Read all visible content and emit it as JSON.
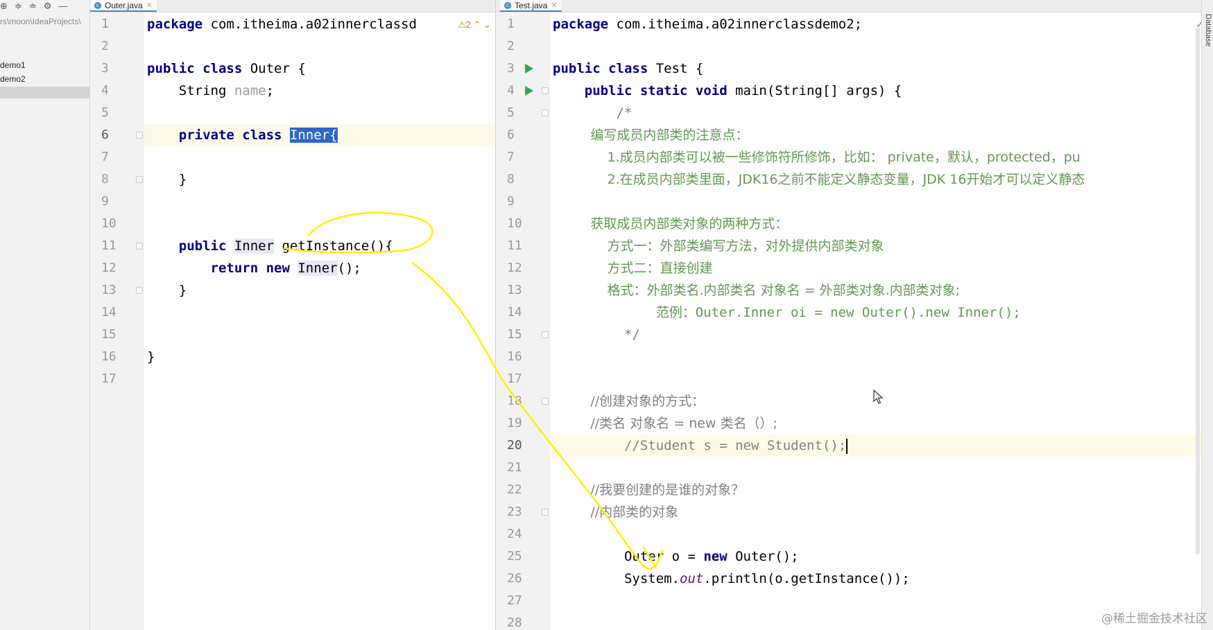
{
  "sidebar": {
    "toolbar_icons": [
      "target-icon",
      "expand-all-icon",
      "collapse-all-icon",
      "gear-icon",
      "minimize-icon"
    ],
    "path": "rs\\moon\\IdeaProjects\\",
    "items": [
      {
        "label": "demo1"
      },
      {
        "label": "demo2"
      }
    ]
  },
  "left_editor": {
    "tab": {
      "label": "Outer.java"
    },
    "warning": {
      "count": "2"
    },
    "lines": [
      "1",
      "2",
      "3",
      "4",
      "5",
      "6",
      "7",
      "8",
      "9",
      "10",
      "11",
      "12",
      "13",
      "14",
      "15",
      "16",
      "17"
    ],
    "code": {
      "l1": {
        "kw": "package",
        "rest": " com.itheima.a02innerclassd"
      },
      "l3": {
        "kw": "public class",
        "rest": " Outer {"
      },
      "l4": {
        "type": "    String ",
        "field": "name",
        ";": ";"
      },
      "l6": {
        "kw": "    private class ",
        "sel": "Inner{"
      },
      "l8": {
        "text": "    }"
      },
      "l11": {
        "kw": "    public ",
        "usage": "Inner",
        "rest": " getInstance(){"
      },
      "l12": {
        "kw": "        return new ",
        "usage": "Inner",
        "rest": "();"
      },
      "l13": {
        "text": "    }"
      },
      "l16": {
        "text": "}"
      }
    }
  },
  "right_editor": {
    "tab": {
      "label": "Test.java"
    },
    "db_label": "Database",
    "lines": [
      "1",
      "2",
      "3",
      "4",
      "5",
      "6",
      "7",
      "8",
      "9",
      "10",
      "11",
      "12",
      "13",
      "14",
      "15",
      "16",
      "17",
      "18",
      "19",
      "20",
      "21",
      "22",
      "23",
      "24",
      "25",
      "26",
      "27",
      "28"
    ],
    "code": {
      "l1": {
        "kw": "package",
        "rest": " com.itheima.a02innerclassdemo2;"
      },
      "l3": {
        "kw": "public class",
        "rest": " Test {"
      },
      "l4": {
        "kw": "    public static void",
        "rest": " main(String[] args) {"
      },
      "l5": "        /*",
      "l6": "         编写成员内部类的注意点：",
      "l7": "             1.成员内部类可以被一些修饰符所修饰，比如： private，默认，protected，pu",
      "l8": "             2.在成员内部类里面，JDK16之前不能定义静态变量，JDK 16开始才可以定义静态",
      "l10": "         获取成员内部类对象的两种方式：",
      "l11": "             方式一：外部类编写方法，对外提供内部类对象",
      "l12": "             方式二：直接创建",
      "l13": "             格式：外部类名.内部类名 对象名 = 外部类对象.内部类对象;",
      "l14": "             范例：Outer.Inner oi = new Outer().new Inner();",
      "l15": "         */",
      "l18": "         //创建对象的方式：",
      "l19": "         //类名 对象名 = new 类名（）;",
      "l20": "         //Student s = new Student();",
      "l22": "         //我要创建的是谁的对象？",
      "l23": "         //内部类的对象",
      "l25": {
        "pre": "         Outer o = ",
        "kw": "new",
        "rest": " Outer();"
      },
      "l26": {
        "pre": "         System.",
        "ital": "out",
        "rest": ".println(o.getInstance());"
      }
    }
  },
  "watermark": "@稀土掘金技术社区",
  "colors": {
    "keyword": "#000080",
    "field": "#660e7a",
    "comment": "#808080",
    "annotation": "#ffee00",
    "selection": "#2f65ca"
  }
}
